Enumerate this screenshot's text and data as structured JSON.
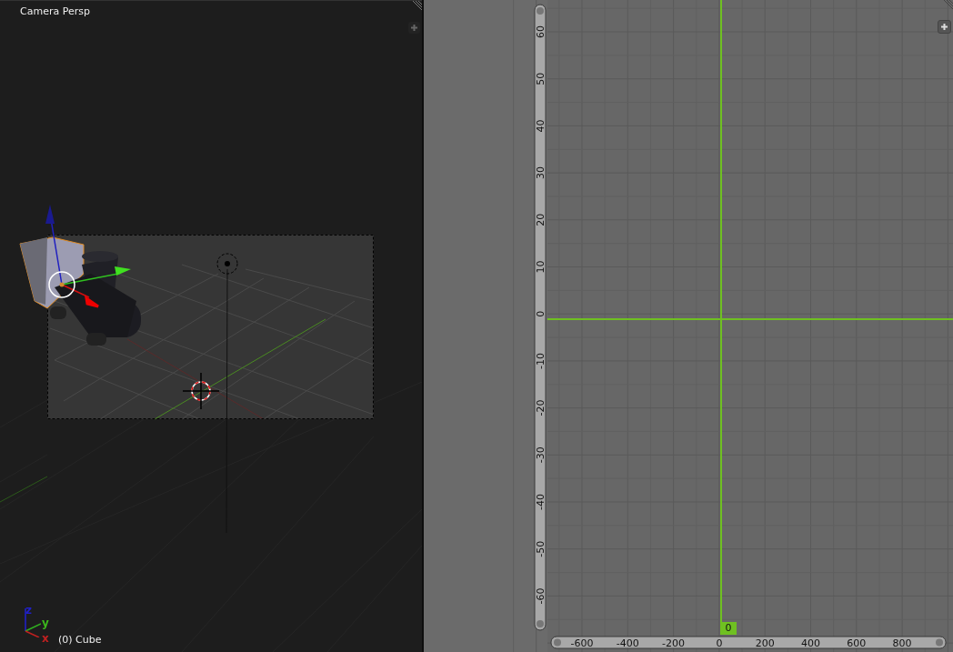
{
  "viewport": {
    "title": "Camera Persp",
    "object_label": "(0) Cube",
    "axis_labels": [
      {
        "text": "z",
        "color": "#2020c8"
      },
      {
        "text": "y",
        "color": "#3cb81c"
      },
      {
        "text": "x",
        "color": "#c02020"
      }
    ]
  },
  "graph_editor": {
    "y_labels": [
      "60",
      "50",
      "40",
      "30",
      "20",
      "10",
      "0",
      "-10",
      "-20",
      "-30",
      "-40",
      "-50",
      "-60"
    ],
    "x_labels": [
      "-600",
      "-400",
      "-200",
      "0",
      "200",
      "400",
      "600",
      "800"
    ],
    "current_frame": "0"
  }
}
